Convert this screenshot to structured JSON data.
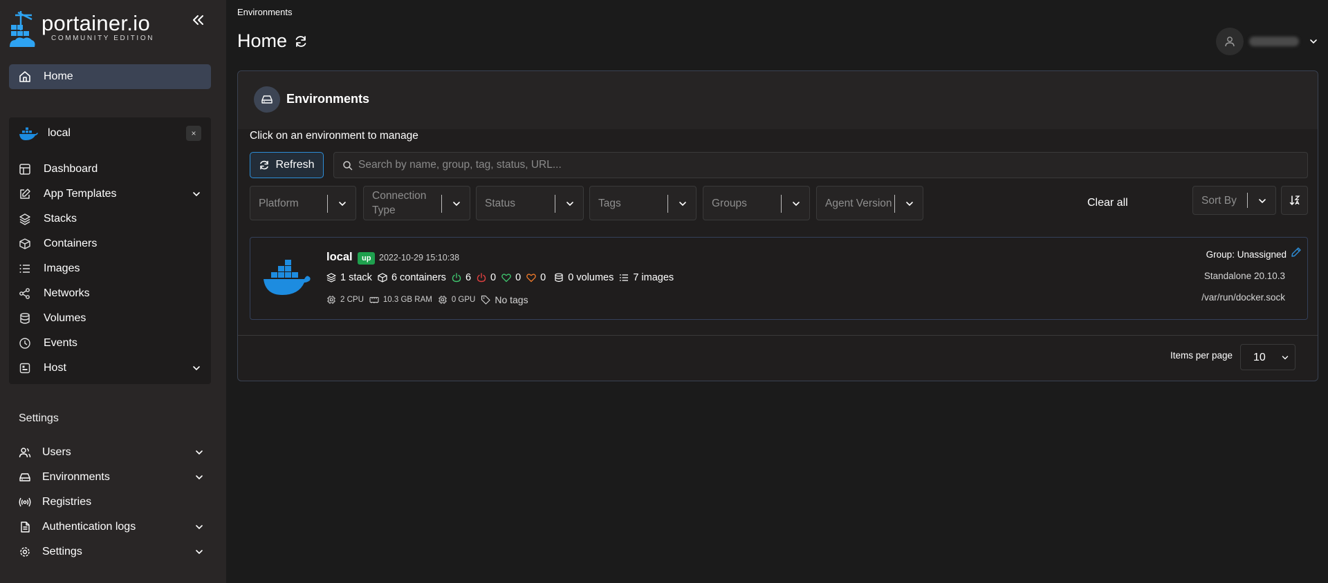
{
  "brand": {
    "name": "portainer.io",
    "edition": "COMMUNITY EDITION"
  },
  "sidebar": {
    "home_label": "Home",
    "environment": {
      "name": "local",
      "close": "×",
      "items": [
        {
          "label": "Dashboard",
          "icon": "dashboard-icon",
          "has_submenu": false
        },
        {
          "label": "App Templates",
          "icon": "edit-icon",
          "has_submenu": true
        },
        {
          "label": "Stacks",
          "icon": "layers-icon",
          "has_submenu": false
        },
        {
          "label": "Containers",
          "icon": "box-icon",
          "has_submenu": false
        },
        {
          "label": "Images",
          "icon": "list-icon",
          "has_submenu": false
        },
        {
          "label": "Networks",
          "icon": "share-icon",
          "has_submenu": false
        },
        {
          "label": "Volumes",
          "icon": "database-icon",
          "has_submenu": false
        },
        {
          "label": "Events",
          "icon": "clock-icon",
          "has_submenu": false
        },
        {
          "label": "Host",
          "icon": "host-icon",
          "has_submenu": true
        }
      ]
    },
    "settings_title": "Settings",
    "settings_items": [
      {
        "label": "Users",
        "icon": "users-icon",
        "has_submenu": true
      },
      {
        "label": "Environments",
        "icon": "hard-drive-icon",
        "has_submenu": true
      },
      {
        "label": "Registries",
        "icon": "radio-icon",
        "has_submenu": false
      },
      {
        "label": "Authentication logs",
        "icon": "file-text-icon",
        "has_submenu": true
      },
      {
        "label": "Settings",
        "icon": "settings-icon",
        "has_submenu": true
      }
    ]
  },
  "header": {
    "breadcrumb": "Environments",
    "title": "Home"
  },
  "panel": {
    "title": "Environments",
    "hint": "Click on an environment to manage",
    "refresh_label": "Refresh",
    "search_placeholder": "Search by name, group, tag, status, URL...",
    "filters": [
      "Platform",
      "Connection Type",
      "Status",
      "Tags",
      "Groups",
      "Agent Version"
    ],
    "clear_all": "Clear all",
    "sort_by": "Sort By"
  },
  "environment_card": {
    "name": "local",
    "status": "up",
    "timestamp": "2022-10-29 15:10:38",
    "stacks": "1 stack",
    "containers": "6 containers",
    "running": "6",
    "stopped": "0",
    "healthy": "0",
    "unhealthy": "0",
    "volumes": "0 volumes",
    "images": "7 images",
    "cpu": "2 CPU",
    "ram": "10.3 GB RAM",
    "gpu": "0 GPU",
    "tags": "No tags",
    "group": "Group: Unassigned",
    "standalone": "Standalone 20.10.3",
    "socket": "/var/run/docker.sock"
  },
  "pagination": {
    "label": "Items per page",
    "value": "10"
  },
  "colors": {
    "accent": "#2d8ed8",
    "docker_blue": "#1d8ce0",
    "status_up": "#1fa04e",
    "running": "#3fc46e",
    "stopped": "#e04040",
    "healthy": "#3fc46e",
    "unhealthy": "#f07a2a"
  }
}
